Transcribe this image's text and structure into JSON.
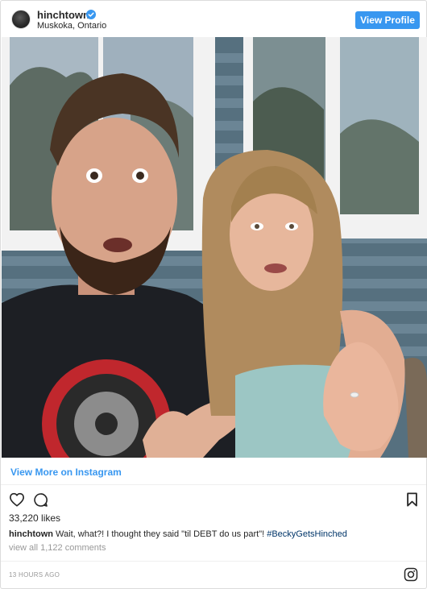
{
  "header": {
    "username": "hinchtown",
    "location": "Muskoka, Ontario",
    "view_profile_label": "View Profile"
  },
  "post": {
    "view_more_label": "View More on Instagram",
    "likes": "33,220 likes",
    "caption_username": "hinchtown",
    "caption_text": " Wait, what?! I thought they said \"til DEBT do us part\"! ",
    "caption_hashtag": "#BeckyGetsHinched",
    "view_comments": "view all 1,122 comments",
    "timestamp": "13 HOURS AGO"
  },
  "colors": {
    "accent": "#3897f0",
    "hashtag": "#003569",
    "muted": "#999999"
  },
  "icons": [
    "verified-badge-icon",
    "heart-icon",
    "comment-icon",
    "bookmark-icon",
    "instagram-logo-icon"
  ]
}
